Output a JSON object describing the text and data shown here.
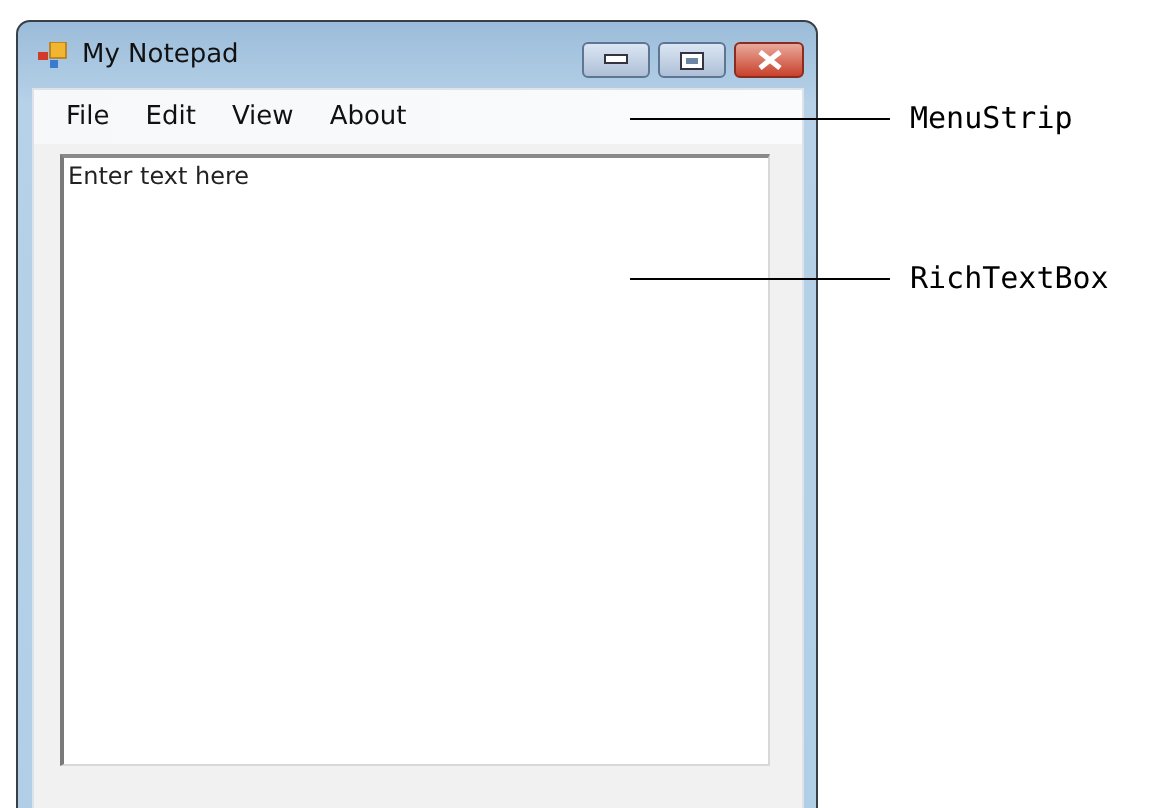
{
  "window": {
    "title": "My Notepad"
  },
  "menu": [
    {
      "label": "File"
    },
    {
      "label": "Edit"
    },
    {
      "label": "View"
    },
    {
      "label": "About"
    }
  ],
  "editor": {
    "placeholder": "Enter text here"
  },
  "annotations": [
    {
      "label": "MenuStrip"
    },
    {
      "label": "RichTextBox"
    }
  ]
}
